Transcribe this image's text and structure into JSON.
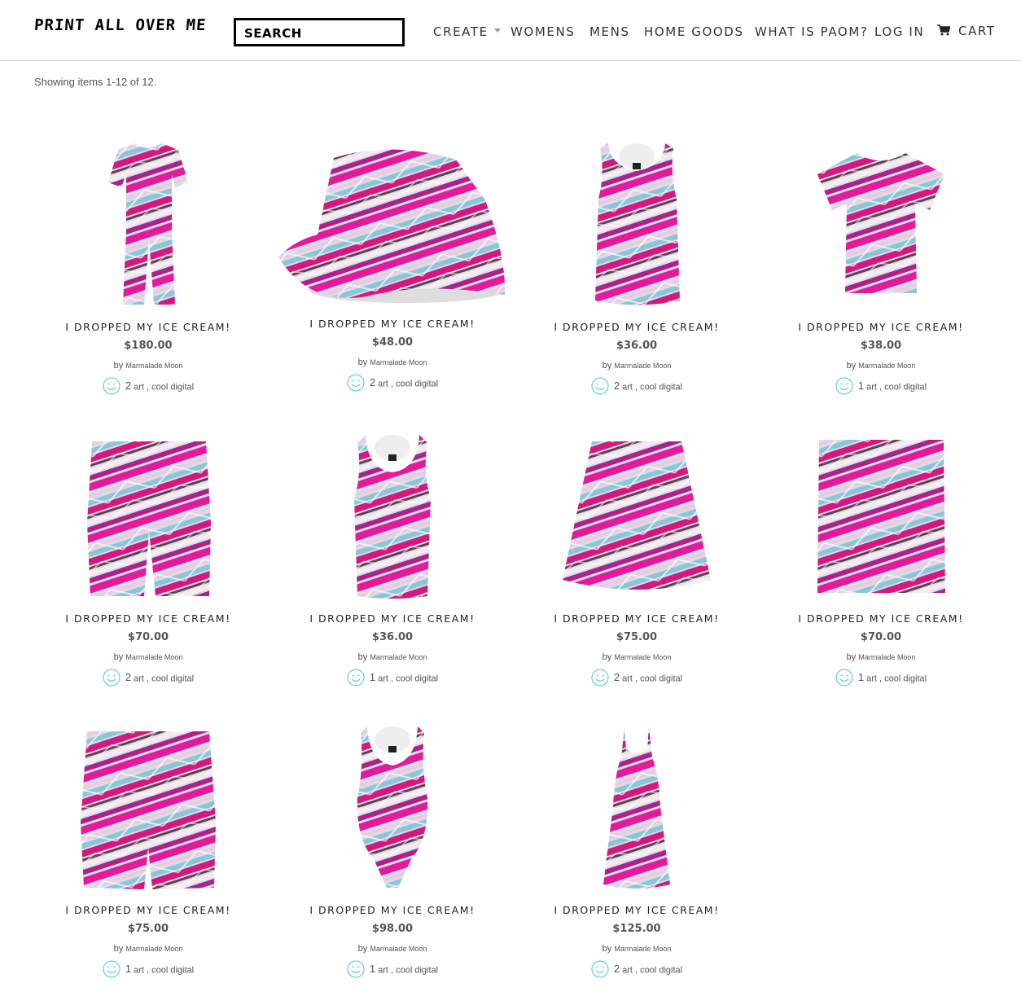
{
  "header": {
    "logo_text": "PRINT ALL OVER ME",
    "search_placeholder": "SEARCH",
    "nav": {
      "create": "CREATE",
      "womens": "WOMENS",
      "mens": "MENS",
      "home_goods": "HOME GOODS",
      "what_is": "WHAT IS PAOM?",
      "login": "LOG IN",
      "cart": "CART"
    },
    "cart_icon": "cart-icon",
    "caret_icon": "chevron-down-icon"
  },
  "results": {
    "showing_text": "Showing items 1-12 of 12."
  },
  "colors": {
    "accent_smile": "#5fd3d0",
    "pattern_pink": "#e6199b",
    "pattern_blue": "#8fc3d6"
  },
  "products": [
    {
      "title": "I DROPPED MY ICE CREAM!",
      "price": "$180.00",
      "by": "by",
      "artist": "Marmalade Moon",
      "likes": "2",
      "tags": "art , cool digital",
      "shape": "jumpsuit"
    },
    {
      "title": "I DROPPED MY ICE CREAM!",
      "price": "$48.00",
      "by": "by",
      "artist": "Marmalade Moon",
      "likes": "2",
      "tags": "art , cool digital",
      "shape": "bucket-hat"
    },
    {
      "title": "I DROPPED MY ICE CREAM!",
      "price": "$36.00",
      "by": "by",
      "artist": "Marmalade Moon",
      "likes": "2",
      "tags": "art , cool digital",
      "shape": "tank-top"
    },
    {
      "title": "I DROPPED MY ICE CREAM!",
      "price": "$38.00",
      "by": "by",
      "artist": "Marmalade Moon",
      "likes": "1",
      "tags": "art , cool digital",
      "shape": "t-shirt"
    },
    {
      "title": "I DROPPED MY ICE CREAM!",
      "price": "$70.00",
      "by": "by",
      "artist": "Marmalade Moon",
      "likes": "2",
      "tags": "art , cool digital",
      "shape": "shorts"
    },
    {
      "title": "I DROPPED MY ICE CREAM!",
      "price": "$36.00",
      "by": "by",
      "artist": "Marmalade Moon",
      "likes": "1",
      "tags": "art , cool digital",
      "shape": "womens-tank"
    },
    {
      "title": "I DROPPED MY ICE CREAM!",
      "price": "$75.00",
      "by": "by",
      "artist": "Marmalade Moon",
      "likes": "2",
      "tags": "art , cool digital",
      "shape": "skirt"
    },
    {
      "title": "I DROPPED MY ICE CREAM!",
      "price": "$70.00",
      "by": "by",
      "artist": "Marmalade Moon",
      "likes": "1",
      "tags": "art , cool digital",
      "shape": "tote"
    },
    {
      "title": "I DROPPED MY ICE CREAM!",
      "price": "$75.00",
      "by": "by",
      "artist": "Marmalade Moon",
      "likes": "1",
      "tags": "art , cool digital",
      "shape": "swim-trunks"
    },
    {
      "title": "I DROPPED MY ICE CREAM!",
      "price": "$98.00",
      "by": "by",
      "artist": "Marmalade Moon",
      "likes": "1",
      "tags": "art , cool digital",
      "shape": "swimsuit"
    },
    {
      "title": "I DROPPED MY ICE CREAM!",
      "price": "$125.00",
      "by": "by",
      "artist": "Marmalade Moon",
      "likes": "2",
      "tags": "art , cool digital",
      "shape": "dress"
    }
  ]
}
